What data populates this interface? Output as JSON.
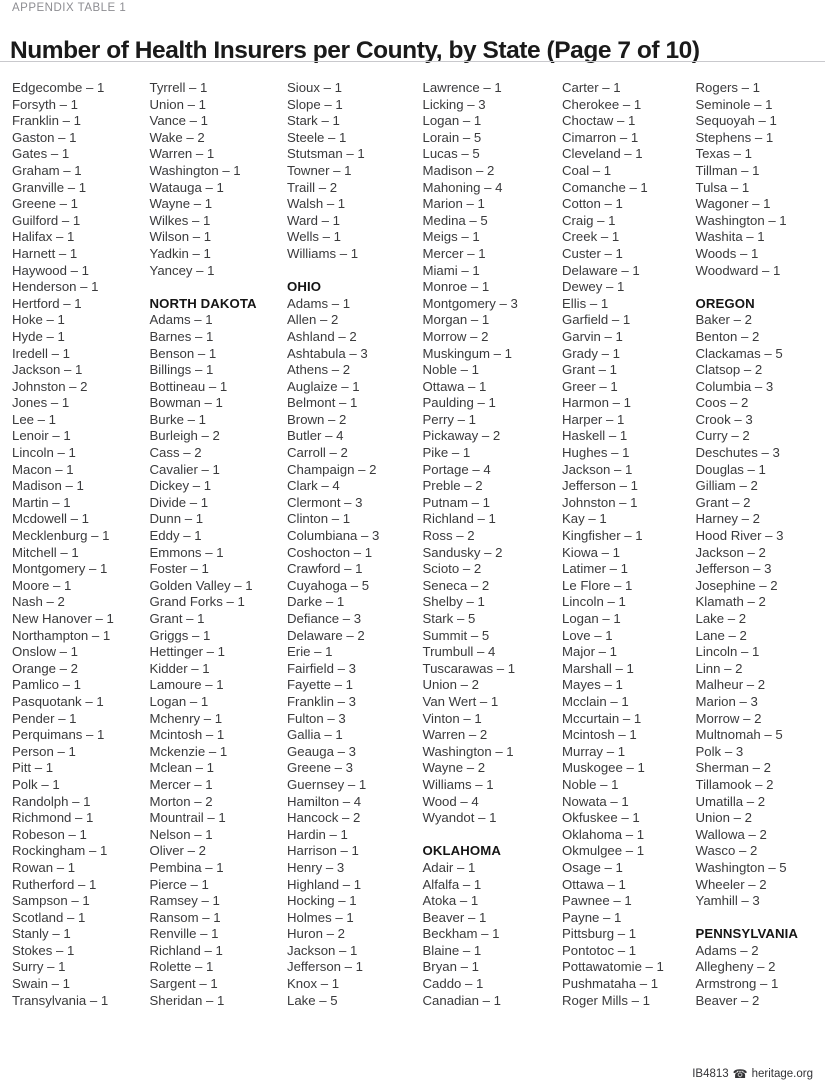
{
  "header": {
    "kicker": "APPENDIX TABLE 1",
    "title": "Number of Health Insurers per County, by State (Page 7 of 10)"
  },
  "footer": {
    "report_id": "IB4813",
    "mark_icon": "heritage-mark-icon",
    "mark_glyph": "☎",
    "site": "heritage.org"
  },
  "columns": [
    {
      "id": "column-1",
      "blocks": [
        {
          "type": "entries",
          "items": [
            "Edgecombe – 1",
            "Forsyth – 1",
            "Franklin – 1",
            "Gaston – 1",
            "Gates – 1",
            "Graham – 1",
            "Granville – 1",
            "Greene – 1",
            "Guilford – 1",
            "Halifax – 1",
            "Harnett – 1",
            "Haywood – 1",
            "Henderson – 1",
            "Hertford – 1",
            "Hoke – 1",
            "Hyde – 1",
            "Iredell – 1",
            "Jackson – 1",
            "Johnston – 2",
            "Jones – 1",
            "Lee – 1",
            "Lenoir – 1",
            "Lincoln – 1",
            "Macon – 1",
            "Madison – 1",
            "Martin – 1",
            "Mcdowell – 1",
            "Mecklenburg – 1",
            "Mitchell – 1",
            "Montgomery – 1",
            "Moore – 1",
            "Nash – 2",
            "New Hanover – 1",
            "Northampton – 1",
            "Onslow – 1",
            "Orange – 2",
            "Pamlico – 1",
            "Pasquotank – 1",
            "Pender – 1",
            "Perquimans – 1",
            "Person – 1",
            "Pitt – 1",
            "Polk – 1",
            "Randolph – 1",
            "Richmond – 1",
            "Robeson – 1",
            "Rockingham – 1",
            "Rowan – 1",
            "Rutherford – 1",
            "Sampson – 1",
            "Scotland – 1",
            "Stanly – 1",
            "Stokes – 1",
            "Surry – 1",
            "Swain – 1",
            "Transylvania – 1"
          ]
        }
      ]
    },
    {
      "id": "column-2",
      "blocks": [
        {
          "type": "entries",
          "items": [
            "Tyrrell – 1",
            "Union – 1",
            "Vance – 1",
            "Wake – 2",
            "Warren – 1",
            "Washington – 1",
            "Watauga – 1",
            "Wayne – 1",
            "Wilkes – 1",
            "Wilson – 1",
            "Yadkin – 1",
            "Yancey – 1"
          ]
        },
        {
          "type": "spacer"
        },
        {
          "type": "state",
          "name": "NORTH DAKOTA"
        },
        {
          "type": "entries",
          "items": [
            "Adams – 1",
            "Barnes – 1",
            "Benson – 1",
            "Billings – 1",
            "Bottineau – 1",
            "Bowman – 1",
            "Burke – 1",
            "Burleigh – 2",
            "Cass – 2",
            "Cavalier – 1",
            "Dickey – 1",
            "Divide – 1",
            "Dunn – 1",
            "Eddy – 1",
            "Emmons – 1",
            "Foster – 1",
            "Golden Valley – 1",
            "Grand Forks – 1",
            "Grant – 1",
            "Griggs – 1",
            "Hettinger – 1",
            "Kidder – 1",
            "Lamoure – 1",
            "Logan – 1",
            "Mchenry – 1",
            "Mcintosh – 1",
            "Mckenzie – 1",
            "Mclean – 1",
            "Mercer – 1",
            "Morton – 2",
            "Mountrail – 1",
            "Nelson – 1",
            "Oliver – 2",
            "Pembina – 1",
            "Pierce – 1",
            "Ramsey – 1",
            "Ransom – 1",
            "Renville – 1",
            "Richland – 1",
            "Rolette – 1",
            "Sargent – 1",
            "Sheridan – 1"
          ]
        }
      ]
    },
    {
      "id": "column-3",
      "blocks": [
        {
          "type": "entries",
          "items": [
            "Sioux – 1",
            "Slope – 1",
            "Stark – 1",
            "Steele – 1",
            "Stutsman – 1",
            "Towner – 1",
            "Traill – 2",
            "Walsh – 1",
            "Ward – 1",
            "Wells – 1",
            "Williams – 1"
          ]
        },
        {
          "type": "spacer"
        },
        {
          "type": "state",
          "name": "OHIO"
        },
        {
          "type": "entries",
          "items": [
            "Adams – 1",
            "Allen – 2",
            "Ashland – 2",
            "Ashtabula – 3",
            "Athens – 2",
            "Auglaize – 1",
            "Belmont – 1",
            "Brown – 2",
            "Butler – 4",
            "Carroll – 2",
            "Champaign – 2",
            "Clark – 4",
            "Clermont – 3",
            "Clinton – 1",
            "Columbiana – 3",
            "Coshocton – 1",
            "Crawford – 1",
            "Cuyahoga – 5",
            "Darke – 1",
            "Defiance – 3",
            "Delaware – 2",
            "Erie – 1",
            "Fairfield – 3",
            "Fayette – 1",
            "Franklin – 3",
            "Fulton – 3",
            "Gallia – 1",
            "Geauga – 3",
            "Greene – 3",
            "Guernsey – 1",
            "Hamilton – 4",
            "Hancock – 2",
            "Hardin – 1",
            "Harrison – 1",
            "Henry – 3",
            "Highland – 1",
            "Hocking – 1",
            "Holmes – 1",
            "Huron – 2",
            "Jackson – 1",
            "Jefferson – 1",
            "Knox – 1",
            "Lake – 5"
          ]
        }
      ]
    },
    {
      "id": "column-4",
      "blocks": [
        {
          "type": "entries",
          "items": [
            "Lawrence – 1",
            "Licking – 3",
            "Logan – 1",
            "Lorain – 5",
            "Lucas – 5",
            "Madison – 2",
            "Mahoning – 4",
            "Marion – 1",
            "Medina – 5",
            "Meigs – 1",
            "Mercer – 1",
            "Miami – 1",
            "Monroe – 1",
            "Montgomery – 3",
            "Morgan – 1",
            "Morrow – 2",
            "Muskingum – 1",
            "Noble – 1",
            "Ottawa – 1",
            "Paulding – 1",
            "Perry – 1",
            "Pickaway – 2",
            "Pike – 1",
            "Portage – 4",
            "Preble – 2",
            "Putnam – 1",
            "Richland – 1",
            "Ross – 2",
            "Sandusky – 2",
            "Scioto – 2",
            "Seneca – 2",
            "Shelby – 1",
            "Stark – 5",
            "Summit – 5",
            "Trumbull – 4",
            "Tuscarawas – 1",
            "Union – 2",
            "Van Wert – 1",
            "Vinton – 1",
            "Warren – 2",
            "Washington – 1",
            "Wayne – 2",
            "Williams – 1",
            "Wood – 4",
            "Wyandot – 1"
          ]
        },
        {
          "type": "spacer"
        },
        {
          "type": "state",
          "name": "OKLAHOMA"
        },
        {
          "type": "entries",
          "items": [
            "Adair – 1",
            "Alfalfa – 1",
            "Atoka – 1",
            "Beaver – 1",
            "Beckham – 1",
            "Blaine – 1",
            "Bryan – 1",
            "Caddo – 1",
            "Canadian – 1"
          ]
        }
      ]
    },
    {
      "id": "column-5",
      "blocks": [
        {
          "type": "entries",
          "items": [
            "Carter – 1",
            "Cherokee – 1",
            "Choctaw – 1",
            "Cimarron – 1",
            "Cleveland – 1",
            "Coal – 1",
            "Comanche – 1",
            "Cotton – 1",
            "Craig – 1",
            "Creek – 1",
            "Custer – 1",
            "Delaware – 1",
            "Dewey – 1",
            "Ellis – 1",
            "Garfield – 1",
            "Garvin – 1",
            "Grady – 1",
            "Grant – 1",
            "Greer – 1",
            "Harmon – 1",
            "Harper – 1",
            "Haskell – 1",
            "Hughes – 1",
            "Jackson – 1",
            "Jefferson – 1",
            "Johnston – 1",
            "Kay – 1",
            "Kingfisher – 1",
            "Kiowa – 1",
            "Latimer – 1",
            "Le Flore – 1",
            "Lincoln – 1",
            "Logan – 1",
            "Love – 1",
            "Major – 1",
            "Marshall – 1",
            "Mayes – 1",
            "Mcclain – 1",
            "Mccurtain – 1",
            "Mcintosh – 1",
            "Murray – 1",
            "Muskogee – 1",
            "Noble – 1",
            "Nowata – 1",
            "Okfuskee – 1",
            "Oklahoma – 1",
            "Okmulgee – 1",
            "Osage – 1",
            "Ottawa – 1",
            "Pawnee – 1",
            "Payne – 1",
            "Pittsburg – 1",
            "Pontotoc – 1",
            "Pottawatomie – 1",
            "Pushmataha – 1",
            "Roger Mills – 1"
          ]
        }
      ]
    },
    {
      "id": "column-6",
      "blocks": [
        {
          "type": "entries",
          "items": [
            "Rogers – 1",
            "Seminole – 1",
            "Sequoyah – 1",
            "Stephens – 1",
            "Texas – 1",
            "Tillman – 1",
            "Tulsa – 1",
            "Wagoner – 1",
            "Washington – 1",
            "Washita – 1",
            "Woods – 1",
            "Woodward – 1"
          ]
        },
        {
          "type": "spacer"
        },
        {
          "type": "state",
          "name": "OREGON"
        },
        {
          "type": "entries",
          "items": [
            "Baker – 2",
            "Benton – 2",
            "Clackamas – 5",
            "Clatsop – 2",
            "Columbia – 3",
            "Coos – 2",
            "Crook – 3",
            "Curry – 2",
            "Deschutes – 3",
            "Douglas – 1",
            "Gilliam – 2",
            "Grant – 2",
            "Harney – 2",
            "Hood River – 3",
            "Jackson – 2",
            "Jefferson – 3",
            "Josephine – 2",
            "Klamath – 2",
            "Lake – 2",
            "Lane – 2",
            "Lincoln – 1",
            "Linn – 2",
            "Malheur – 2",
            "Marion – 3",
            "Morrow – 2",
            "Multnomah – 5",
            "Polk – 3",
            "Sherman – 2",
            "Tillamook – 2",
            "Umatilla – 2",
            "Union – 2",
            "Wallowa – 2",
            "Wasco – 2",
            "Washington – 5",
            "Wheeler – 2",
            "Yamhill – 3"
          ]
        },
        {
          "type": "spacer"
        },
        {
          "type": "state",
          "name": "PENNSYLVANIA"
        },
        {
          "type": "entries",
          "items": [
            "Adams – 2",
            "Allegheny – 2",
            "Armstrong – 1",
            "Beaver – 2"
          ]
        }
      ]
    }
  ]
}
